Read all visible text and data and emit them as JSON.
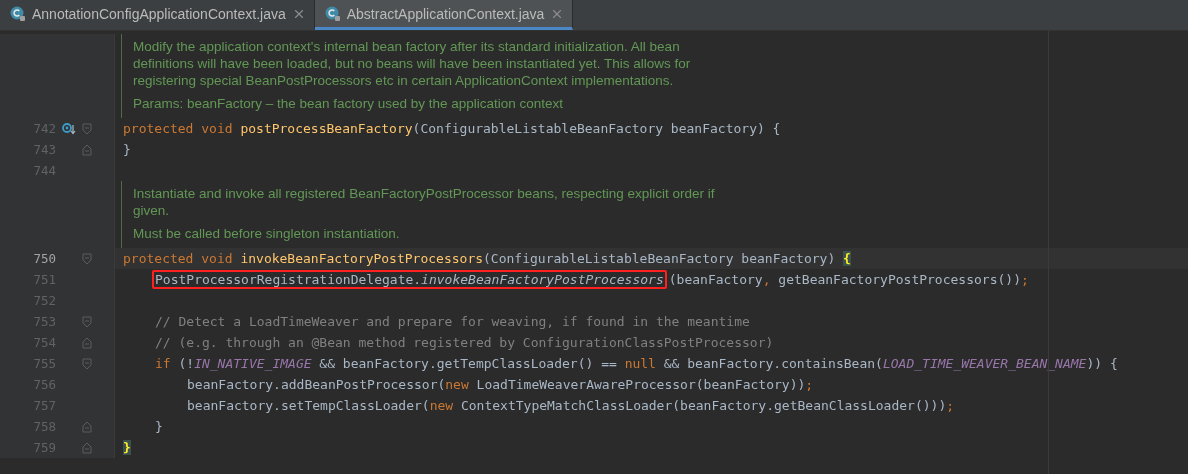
{
  "tabs": [
    {
      "label": "AnnotationConfigApplicationContext.java",
      "selected": false
    },
    {
      "label": "AbstractApplicationContext.java",
      "selected": true
    }
  ],
  "editor": {
    "blocks": [
      {
        "kind": "doc",
        "paragraphs": [
          "Modify the application context's internal bean factory after its standard initialization. All bean definitions will have been loaded, but no beans will have been instantiated yet. This allows for registering special BeanPostProcessors etc in certain ApplicationContext implementations.",
          "Params: beanFactory – the bean factory used by the application context"
        ]
      },
      {
        "kind": "code",
        "number": "742",
        "override": true,
        "fold_start": true,
        "fold_end": false,
        "current": false,
        "tokens": [
          {
            "kind": "keyword",
            "text": "protected void "
          },
          {
            "kind": "method",
            "text": "postProcessBeanFactory"
          },
          {
            "kind": "plain",
            "text": "(ConfigurableListableBeanFactory beanFactory) {"
          }
        ]
      },
      {
        "kind": "code",
        "number": "743",
        "override": false,
        "fold_start": false,
        "fold_end": true,
        "current": false,
        "tokens": [
          {
            "kind": "plain",
            "text": "}"
          }
        ]
      },
      {
        "kind": "code",
        "number": "744",
        "override": false,
        "fold_start": false,
        "fold_end": false,
        "current": false
      },
      {
        "kind": "doc",
        "paragraphs": [
          "Instantiate and invoke all registered BeanFactoryPostProcessor beans, respecting explicit order if given.",
          "Must be called before singleton instantiation."
        ]
      },
      {
        "kind": "code",
        "number": "750",
        "override": false,
        "fold_start": true,
        "fold_end": false,
        "current": true,
        "tokens": [
          {
            "kind": "keyword",
            "text": "protected void "
          },
          {
            "kind": "method",
            "text": "invokeBeanFactoryPostProcessors"
          },
          {
            "kind": "plain",
            "text": "(ConfigurableListableBeanFactory beanFactory) "
          },
          {
            "kind": "brace-match",
            "text": "{"
          }
        ],
        "children": [
          {
            "kind": "code",
            "number": "751",
            "override": false,
            "fold_start": false,
            "fold_end": false,
            "current": false,
            "tokens": [
              {
                "kind": "group",
                "tokens": [
                  {
                    "kind": "plain",
                    "text": "PostProcessorRegistrationDelegate."
                  },
                  {
                    "kind": "static",
                    "text": "invokeBeanFactoryPostProcessors"
                  }
                ]
              },
              {
                "kind": "plain",
                "text": "(beanFactory"
              },
              {
                "kind": "punct",
                "text": ", "
              },
              {
                "kind": "plain",
                "text": "getBeanFactoryPostProcessors())"
              },
              {
                "kind": "punct",
                "text": ";"
              }
            ]
          },
          {
            "kind": "code",
            "number": "752",
            "override": false,
            "fold_start": false,
            "fold_end": false,
            "current": false
          },
          {
            "kind": "code",
            "number": "753",
            "override": false,
            "fold_start": true,
            "fold_end": false,
            "current": false,
            "tokens": [
              {
                "kind": "comment",
                "text": "// Detect a LoadTimeWeaver and prepare for weaving, if found in the meantime"
              }
            ]
          },
          {
            "kind": "code",
            "number": "754",
            "override": false,
            "fold_start": false,
            "fold_end": true,
            "current": false,
            "tokens": [
              {
                "kind": "comment",
                "text": "// (e.g. through an @Bean method registered by ConfigurationClassPostProcessor)"
              }
            ]
          },
          {
            "kind": "code",
            "number": "755",
            "override": false,
            "fold_start": true,
            "fold_end": false,
            "current": false,
            "tokens": [
              {
                "kind": "keyword",
                "text": "if "
              },
              {
                "kind": "plain",
                "text": "(!"
              },
              {
                "kind": "constant",
                "text": "IN_NATIVE_IMAGE"
              },
              {
                "kind": "plain",
                "text": " && beanFactory.getTempClassLoader() == "
              },
              {
                "kind": "keyword",
                "text": "null"
              },
              {
                "kind": "plain",
                "text": " && beanFactory.containsBean("
              },
              {
                "kind": "constant",
                "text": "LOAD_TIME_WEAVER_BEAN_NAME"
              },
              {
                "kind": "plain",
                "text": ")) {"
              }
            ],
            "children": [
              {
                "kind": "code",
                "number": "756",
                "override": false,
                "fold_start": false,
                "fold_end": false,
                "current": false,
                "tokens": [
                  {
                    "kind": "plain",
                    "text": "beanFactory.addBeanPostProcessor("
                  },
                  {
                    "kind": "keyword",
                    "text": "new "
                  },
                  {
                    "kind": "plain",
                    "text": "LoadTimeWeaverAwareProcessor(beanFactory))"
                  },
                  {
                    "kind": "punct",
                    "text": ";"
                  }
                ]
              },
              {
                "kind": "code",
                "number": "757",
                "override": false,
                "fold_start": false,
                "fold_end": false,
                "current": false,
                "tokens": [
                  {
                    "kind": "plain",
                    "text": "beanFactory.setTempClassLoader("
                  },
                  {
                    "kind": "keyword",
                    "text": "new "
                  },
                  {
                    "kind": "plain",
                    "text": "ContextTypeMatchClassLoader(beanFactory.getBeanClassLoader()))"
                  },
                  {
                    "kind": "punct",
                    "text": ";"
                  }
                ]
              }
            ]
          },
          {
            "kind": "code",
            "number": "758",
            "override": false,
            "fold_start": false,
            "fold_end": true,
            "current": false,
            "tokens": [
              {
                "kind": "plain",
                "text": "}"
              }
            ]
          }
        ]
      },
      {
        "kind": "code",
        "number": "759",
        "override": false,
        "fold_start": false,
        "fold_end": true,
        "current": false,
        "tokens": [
          {
            "kind": "brace-match",
            "text": "}"
          }
        ]
      }
    ]
  }
}
